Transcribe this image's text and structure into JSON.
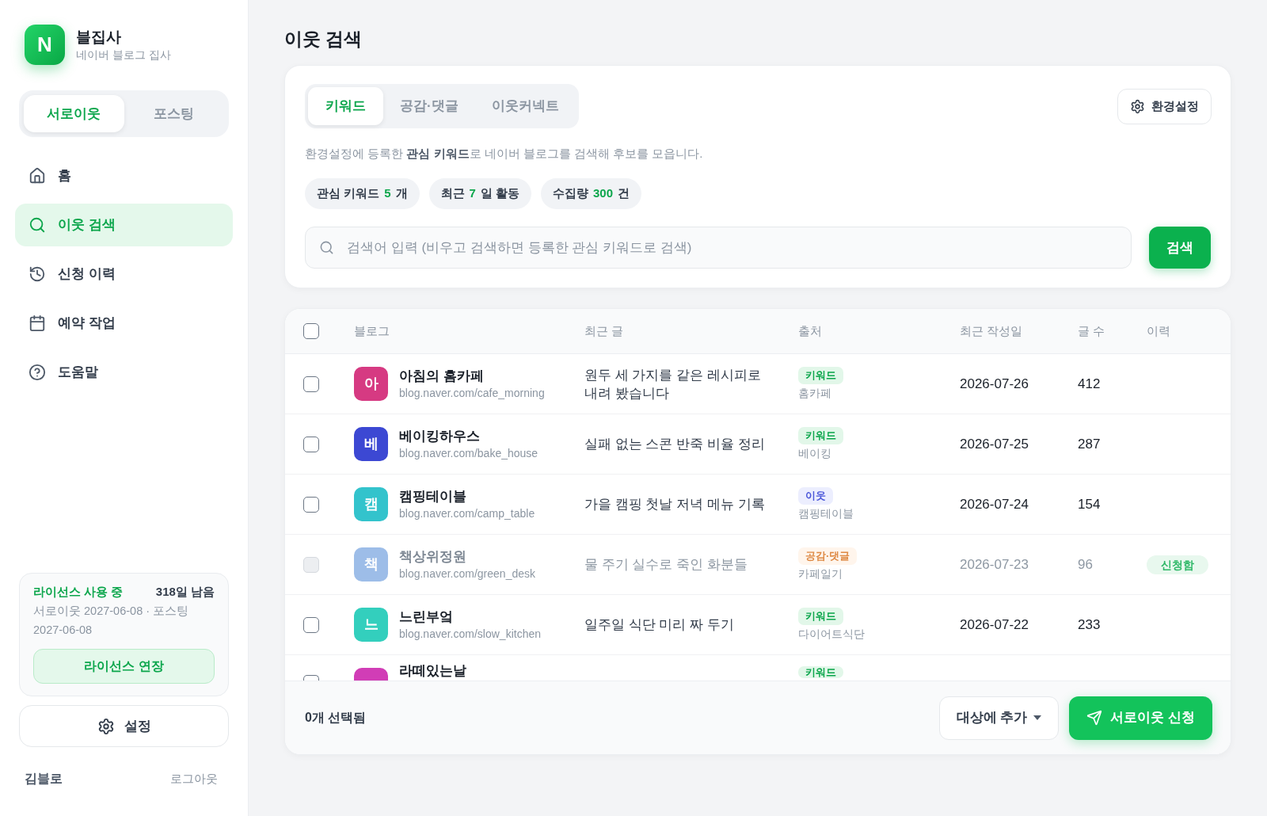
{
  "sidebar": {
    "brand": {
      "logo": "N",
      "title": "블집사",
      "subtitle": "네이버 블로그 집사"
    },
    "modes": [
      {
        "label": "서로이웃",
        "selected": true
      },
      {
        "label": "포스팅",
        "selected": false
      }
    ],
    "nav": [
      {
        "kind": "home",
        "label": "홈",
        "selected": false
      },
      {
        "kind": "search",
        "label": "이웃 검색",
        "selected": true
      },
      {
        "kind": "history",
        "label": "신청 이력",
        "selected": false
      },
      {
        "kind": "calendar",
        "label": "예약 작업",
        "selected": false
      },
      {
        "kind": "help",
        "label": "도움말",
        "selected": false
      }
    ],
    "license": {
      "status": "라이선스 사용 중",
      "remaining": "318일 남음",
      "detail": "서로이웃 2027-06-08 · 포스팅 2027-06-08",
      "button": "라이선스 연장"
    },
    "settings_button": "설정",
    "user": {
      "name": "김블로",
      "logout": "로그아웃"
    }
  },
  "page_title": "이웃 검색",
  "search_panel": {
    "tabs": [
      {
        "label": "키워드",
        "selected": true
      },
      {
        "label": "공감·댓글",
        "selected": false
      },
      {
        "label": "이웃커넥트",
        "selected": false
      }
    ],
    "settings_button": "환경설정",
    "description": "환경설정에 등록한 **관심 키워드**로 네이버 블로그를 검색해 후보를 모읍니다.",
    "stats": [
      {
        "label": "관심 키워드",
        "value": "5",
        "unit": "개"
      },
      {
        "label": "최근",
        "value": "7",
        "unit": "일 활동"
      },
      {
        "label": "수집량",
        "value": "300",
        "unit": "건"
      }
    ],
    "search_field": {
      "placeholder": "검색어 입력 (비우고 검색하면 등록한 관심 키워드로 검색)"
    },
    "search_button": "검색"
  },
  "table": {
    "select_all": {
      "checked": false
    },
    "columns": [
      "블로그",
      "최근 글",
      "출처",
      "최근 작성일",
      "글 수",
      "이력"
    ],
    "rows": [
      {
        "kind": "full",
        "checked": false,
        "disabled": false,
        "avatar": "아",
        "color": "#d63a82",
        "name": "아침의 홈카페",
        "url": "blog.naver.com/cafe_morning",
        "recent_post": "원두 세 가지를 같은 레시피로 내려 봤습니다",
        "source": {
          "kind": "keyword",
          "label": "키워드",
          "detail": "홈카페"
        },
        "date": "2026-07-26",
        "posts": "412"
      },
      {
        "kind": "full",
        "checked": false,
        "disabled": false,
        "avatar": "베",
        "color": "#3c48d3",
        "name": "베이킹하우스",
        "url": "blog.naver.com/bake_house",
        "recent_post": "실패 없는 스콘 반죽 비율 정리",
        "source": {
          "kind": "keyword",
          "label": "키워드",
          "detail": "베이킹"
        },
        "date": "2026-07-25",
        "posts": "287"
      },
      {
        "kind": "full",
        "checked": false,
        "disabled": false,
        "avatar": "캠",
        "color": "#33c3cc",
        "name": "캠핑테이블",
        "url": "blog.naver.com/camp_table",
        "recent_post": "가을 캠핑 첫날 저녁 메뉴 기록",
        "source": {
          "kind": "neighbor",
          "label": "이웃",
          "detail": "캠핑테이블"
        },
        "date": "2026-07-24",
        "posts": "154"
      },
      {
        "kind": "full",
        "checked": false,
        "disabled": true,
        "avatar": "책",
        "color": "#9dbde8",
        "name": "책상위정원",
        "url": "blog.naver.com/green_desk",
        "recent_post": "물 주기 실수로 죽인 화분들",
        "source": {
          "kind": "reaction",
          "label": "공감·댓글",
          "detail": "카페일기"
        },
        "date": "2026-07-23",
        "posts": "96",
        "history": "신청함"
      },
      {
        "kind": "full",
        "checked": false,
        "disabled": false,
        "avatar": "느",
        "color": "#33cfbd",
        "name": "느린부엌",
        "url": "blog.naver.com/slow_kitchen",
        "recent_post": "일주일 식단 미리 짜 두기",
        "source": {
          "kind": "keyword",
          "label": "키워드",
          "detail": "다이어트식단"
        },
        "date": "2026-07-22",
        "posts": "233"
      },
      {
        "kind": "cut",
        "checked": false,
        "color": "#d13db6",
        "name": "라떼있는날",
        "source": {
          "kind": "keyword",
          "label": "키워드"
        }
      }
    ]
  },
  "footer": {
    "selected_count": "0개 선택됨",
    "add_button": "대상에 추가",
    "apply_button": "서로이웃 신청"
  }
}
